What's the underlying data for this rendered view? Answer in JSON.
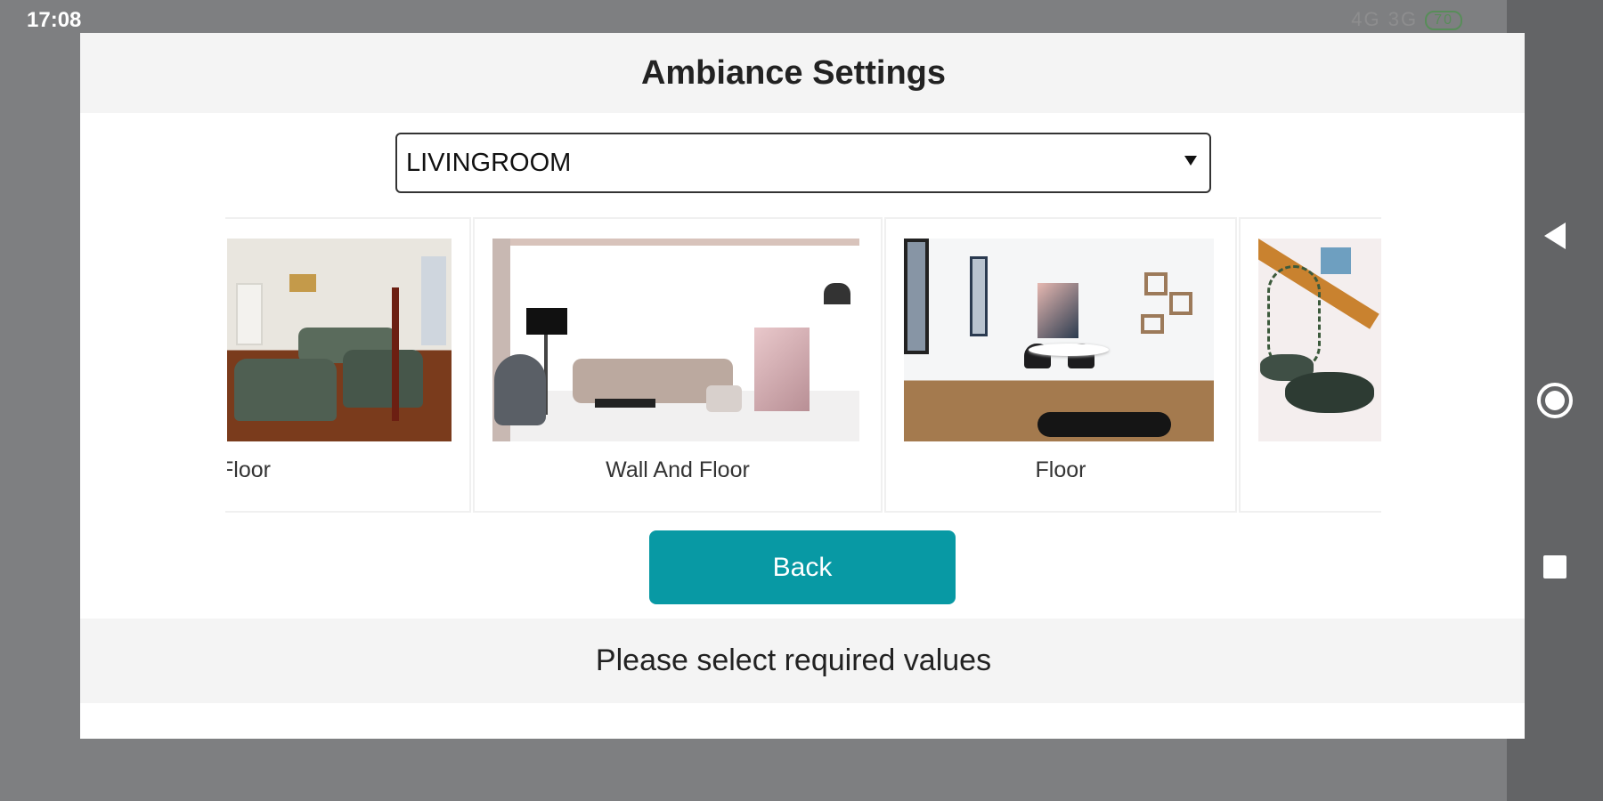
{
  "status_bar": {
    "time": "17:08",
    "network_1": "4G",
    "network_2": "3G",
    "battery": "70"
  },
  "dialog": {
    "title": "Ambiance Settings",
    "room_select": {
      "value": "LIVINGROOM"
    },
    "cards": [
      {
        "label": "Floor"
      },
      {
        "label": "Wall And Floor"
      },
      {
        "label": "Floor"
      },
      {
        "label": ""
      }
    ],
    "back_label": "Back",
    "footer_message": "Please select required values"
  },
  "colors": {
    "accent": "#0899a4",
    "dialog_header_bg": "#f4f4f4",
    "backdrop": "#7e7f81",
    "nav_bar": "#636466"
  },
  "nav_icons": [
    "back-triangle-icon",
    "home-circle-icon",
    "recents-square-icon"
  ]
}
